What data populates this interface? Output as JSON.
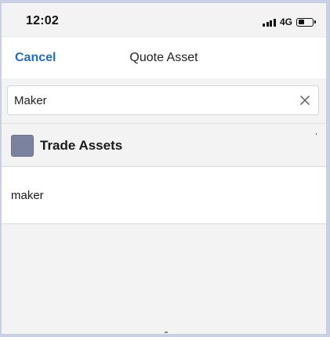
{
  "status_bar": {
    "time": "12:02",
    "network": "4G",
    "battery_level": 0.45,
    "signal_bars": 4
  },
  "nav": {
    "cancel_label": "Cancel",
    "title": "Quote Asset"
  },
  "search": {
    "value": "Maker",
    "clear_icon": "close-icon"
  },
  "section": {
    "title": "Trade Assets",
    "icon_color": "#7b82a0"
  },
  "results": [
    {
      "label": "maker"
    }
  ],
  "colors": {
    "accent": "#1f6ec4",
    "background": "#f3f3f3"
  }
}
